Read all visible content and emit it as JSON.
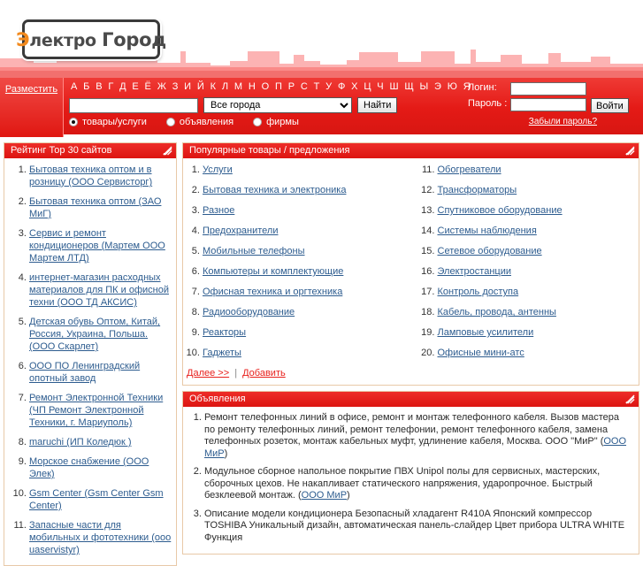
{
  "site": {
    "logo_text_accent": "Э",
    "logo_text_rest": "лектро ",
    "logo_text_second": "Город",
    "accent_red": "#e8201c",
    "accent_orange": "#f28a1e",
    "link_blue": "#2d5c8f"
  },
  "header": {
    "promo_link": "Разместить",
    "alphabet": [
      "А",
      "Б",
      "В",
      "Г",
      "Д",
      "Е",
      "Ё",
      "Ж",
      "З",
      "И",
      "Й",
      "К",
      "Л",
      "М",
      "Н",
      "О",
      "П",
      "Р",
      "С",
      "Т",
      "У",
      "Ф",
      "Х",
      "Ц",
      "Ч",
      "Ш",
      "Щ",
      "Ы",
      "Э",
      "Ю",
      "Я"
    ]
  },
  "search": {
    "query_value": "",
    "query_placeholder": "",
    "city_selected": "Все города",
    "city_options": [
      "Все города"
    ],
    "find_label": "Найти",
    "radios": [
      {
        "label": "товары/услуги",
        "selected": true
      },
      {
        "label": "объявления",
        "selected": false
      },
      {
        "label": "фирмы",
        "selected": false
      }
    ]
  },
  "login": {
    "login_label": "Логин:",
    "password_label": "Пароль :",
    "login_value": "",
    "password_value": "",
    "submit_label": "Войти",
    "forgot_label": "Забыли пароль?"
  },
  "rating_panel": {
    "title": "Рейтинг Тор 30 сайтов",
    "items": [
      "Бытовая техника оптом и в розницу (ООО Сервисторг)",
      "Бытовая техника оптом (ЗАО МиГ)",
      "Сервис и ремонт кондиционеров (Мартем ООО Мартем ЛТД)",
      "интернет-магазин расходных материалов для ПК и офисной техни (ООО ТД АКСИС)",
      "Детская обувь Оптом, Китай, Россия, Украина, Польша. (ООО Скарлет)",
      "ООО ПО Ленинградский опотный завод",
      "Ремонт Электронной Техники (ЧП Ремонт Электронной Техники, г. Мариуполь)",
      "maruchi (ИП Коледюк )",
      "Морское снабжение (ООО Элек)",
      "Gsm Center (Gsm Center Gsm Center)",
      "Запасные части для мобильных и фототехники (ooo uaservistyr)"
    ]
  },
  "popular_panel": {
    "title": "Популярные товары / предложения",
    "items_left": [
      "Услуги",
      "Бытовая техника и электроника",
      "Разное",
      "Предохранители",
      "Мобильные телефоны",
      "Компьютеры и комплектующие",
      "Офисная техника и оргтехника",
      "Радиооборудование",
      "Реакторы",
      "Гаджеты"
    ],
    "items_right": [
      "Обогреватели",
      "Трансформаторы",
      "Спутниковое оборудование",
      "Системы наблюдения",
      "Сетевое оборудование",
      "Электростанции",
      "Контроль доступа",
      "Кабель, провода, антенны",
      "Ламповые усилители",
      "Офисные мини-атс"
    ],
    "more_label": "Далее >>",
    "add_label": "Добавить",
    "separator": "|"
  },
  "ads_panel": {
    "title": "Объявления",
    "items": [
      {
        "text": "Ремонт телефонных линий в офисе, ремонт и монтаж телефонного кабеля. Вызов мастера по ремонту телефонных линий, ремонт телефонии, ремонт телефонного кабеля, замена телефонных розеток, монтаж кабельных муфт, удлинение кабеля, Москва. ООО \"МиР\" (",
        "link": "ООО МиР",
        "tail": ")"
      },
      {
        "text": "Модульное сборное напольное покрытие ПВХ Unipol полы для сервисных, мастерских, сборочных цехов. Не накапливает статического напряжения, ударопрочное. Быстрый безклеевой монтаж. (",
        "link": "ООО МиР",
        "tail": ")"
      },
      {
        "text": "Описание модели кондиционера Безопасный хладагент R410A Японский компрессор TOSHIBA Уникальный дизайн, автоматическая панель-слайдер Цвет прибора ULTRA WHITE Функция",
        "link": "",
        "tail": ""
      }
    ]
  }
}
